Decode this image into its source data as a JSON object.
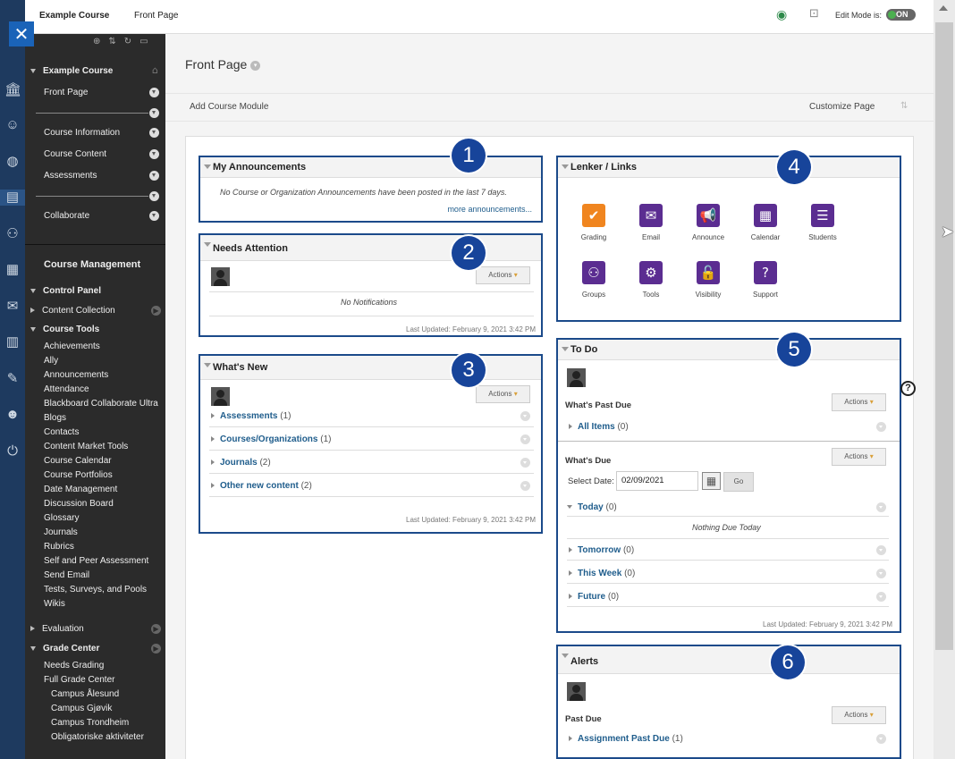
{
  "topbar": {
    "course": "Example Course",
    "page": "Front Page",
    "edit_mode_label": "Edit Mode is:",
    "edit_mode_value": "ON"
  },
  "sidebar": {
    "course_title": "Example Course",
    "menu": [
      "Front Page",
      "Course Information",
      "Course Content",
      "Assessments",
      "Collaborate"
    ],
    "management_title": "Course Management",
    "control_panel": "Control Panel",
    "content_collection": "Content Collection",
    "course_tools": "Course Tools",
    "tools": [
      "Achievements",
      "Ally",
      "Announcements",
      "Attendance",
      "Blackboard Collaborate Ultra",
      "Blogs",
      "Contacts",
      "Content Market Tools",
      "Course Calendar",
      "Course Portfolios",
      "Date Management",
      "Discussion Board",
      "Glossary",
      "Journals",
      "Rubrics",
      "Self and Peer Assessment",
      "Send Email",
      "Tests, Surveys, and Pools",
      "Wikis"
    ],
    "evaluation": "Evaluation",
    "grade_center": "Grade Center",
    "grade_items": [
      "Needs Grading",
      "Full Grade Center"
    ],
    "grade_sub": [
      "Campus Ålesund",
      "Campus Gjøvik",
      "Campus Trondheim",
      "Obligatoriske aktiviteter"
    ]
  },
  "main": {
    "title": "Front Page",
    "add_module": "Add Course Module",
    "customize": "Customize Page"
  },
  "announcements": {
    "badge": "1",
    "title": "My Announcements",
    "empty": "No Course or Organization Announcements have been posted in the last 7 days.",
    "more": "more announcements..."
  },
  "needs_attention": {
    "badge": "2",
    "title": "Needs Attention",
    "actions": "Actions",
    "empty": "No Notifications",
    "updated": "Last Updated: February 9, 2021 3:42 PM"
  },
  "whats_new": {
    "badge": "3",
    "title": "What's New",
    "actions": "Actions",
    "items": [
      {
        "label": "Assessments",
        "count": "(1)"
      },
      {
        "label": "Courses/Organizations",
        "count": "(1)"
      },
      {
        "label": "Journals",
        "count": "(2)"
      },
      {
        "label": "Other new content",
        "count": "(2)"
      }
    ],
    "updated": "Last Updated: February 9, 2021 3:42 PM"
  },
  "links": {
    "badge": "4",
    "title": "Lenker / Links",
    "items": [
      {
        "label": "Grading",
        "icon": "check-icon",
        "color": "#f0851f"
      },
      {
        "label": "Email",
        "icon": "envelope-icon",
        "color": "#5b2d91"
      },
      {
        "label": "Announce",
        "icon": "megaphone-icon",
        "color": "#5b2d91"
      },
      {
        "label": "Calendar",
        "icon": "calendar-icon",
        "color": "#5b2d91"
      },
      {
        "label": "Students",
        "icon": "address-book-icon",
        "color": "#5b2d91"
      },
      {
        "label": "Groups",
        "icon": "group-icon",
        "color": "#5b2d91"
      },
      {
        "label": "Tools",
        "icon": "gear-icon",
        "color": "#5b2d91"
      },
      {
        "label": "Visibility",
        "icon": "unlock-icon",
        "color": "#5b2d91"
      },
      {
        "label": "Support",
        "icon": "question-icon",
        "color": "#5b2d91"
      }
    ]
  },
  "todo": {
    "badge": "5",
    "title": "To Do",
    "actions": "Actions",
    "past_due": "What's Past Due",
    "all_items": "All Items",
    "all_items_count": "(0)",
    "whats_due": "What's Due",
    "select_date": "Select Date:",
    "date_value": "02/09/2021",
    "go": "Go",
    "today": "Today",
    "today_count": "(0)",
    "nothing": "Nothing Due Today",
    "rows": [
      {
        "label": "Tomorrow",
        "count": "(0)"
      },
      {
        "label": "This Week",
        "count": "(0)"
      },
      {
        "label": "Future",
        "count": "(0)"
      }
    ],
    "updated": "Last Updated: February 9, 2021 3:42 PM"
  },
  "alerts": {
    "badge": "6",
    "title": "Alerts",
    "actions": "Actions",
    "past_due": "Past Due",
    "item": "Assignment Past Due",
    "item_count": "(1)"
  },
  "colors": {
    "accent": "#17449a",
    "sidebar": "#2b2b2b",
    "rail": "#1e3a5f",
    "link": "#1f5d8c"
  }
}
